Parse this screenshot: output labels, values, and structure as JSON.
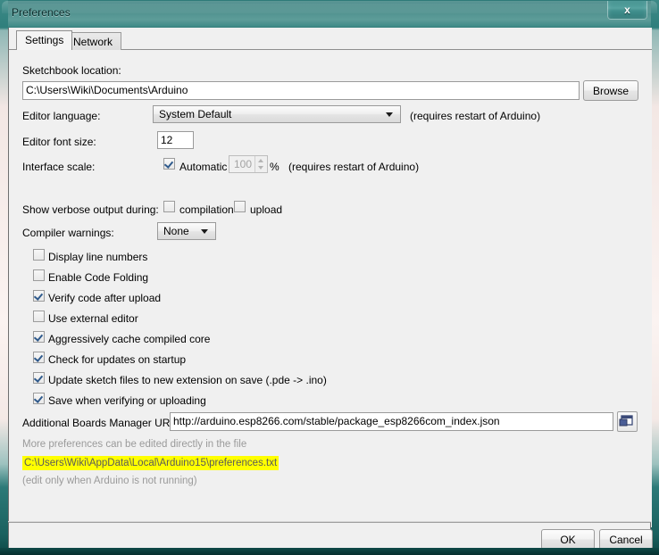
{
  "window": {
    "title": "Preferences",
    "close_label": "x"
  },
  "tabs": [
    {
      "id": "settings",
      "label": "Settings",
      "active": true
    },
    {
      "id": "network",
      "label": "Network",
      "active": false
    }
  ],
  "settings": {
    "sketchbook": {
      "label": "Sketchbook location:",
      "value": "C:\\Users\\Wiki\\Documents\\Arduino",
      "browse_label": "Browse"
    },
    "editor_language": {
      "label": "Editor language:",
      "value": "System Default",
      "note": "(requires restart of Arduino)"
    },
    "editor_font_size": {
      "label": "Editor font size:",
      "value": "12"
    },
    "interface_scale": {
      "label": "Interface scale:",
      "automatic_label": "Automatic",
      "automatic_checked": true,
      "value": "100",
      "percent": "%",
      "note": "(requires restart of Arduino)"
    },
    "verbose_output": {
      "label": "Show verbose output during:",
      "compilation_label": "compilation",
      "compilation_checked": false,
      "upload_label": "upload",
      "upload_checked": false
    },
    "compiler_warnings": {
      "label": "Compiler warnings:",
      "value": "None"
    },
    "checkboxes": [
      {
        "label": "Display line numbers",
        "checked": false
      },
      {
        "label": "Enable Code Folding",
        "checked": false
      },
      {
        "label": "Verify code after upload",
        "checked": true
      },
      {
        "label": "Use external editor",
        "checked": false
      },
      {
        "label": "Aggressively cache compiled core",
        "checked": true
      },
      {
        "label": "Check for updates on startup",
        "checked": true
      },
      {
        "label": "Update sketch files to new extension on save (.pde -> .ino)",
        "checked": true
      },
      {
        "label": "Save when verifying or uploading",
        "checked": true
      }
    ],
    "boards_urls": {
      "label": "Additional Boards Manager URLs:",
      "value": "http://arduino.esp8266.com/stable/package_esp8266com_index.json",
      "expand_icon": "window-expand-icon"
    },
    "footer": {
      "line1": "More preferences can be edited directly in the file",
      "path": "C:\\Users\\Wiki\\AppData\\Local\\Arduino15\\preferences.txt",
      "line3": "(edit only when Arduino is not running)",
      "highlight_color": "#ffff00"
    }
  },
  "buttons": {
    "ok": "OK",
    "cancel": "Cancel"
  }
}
